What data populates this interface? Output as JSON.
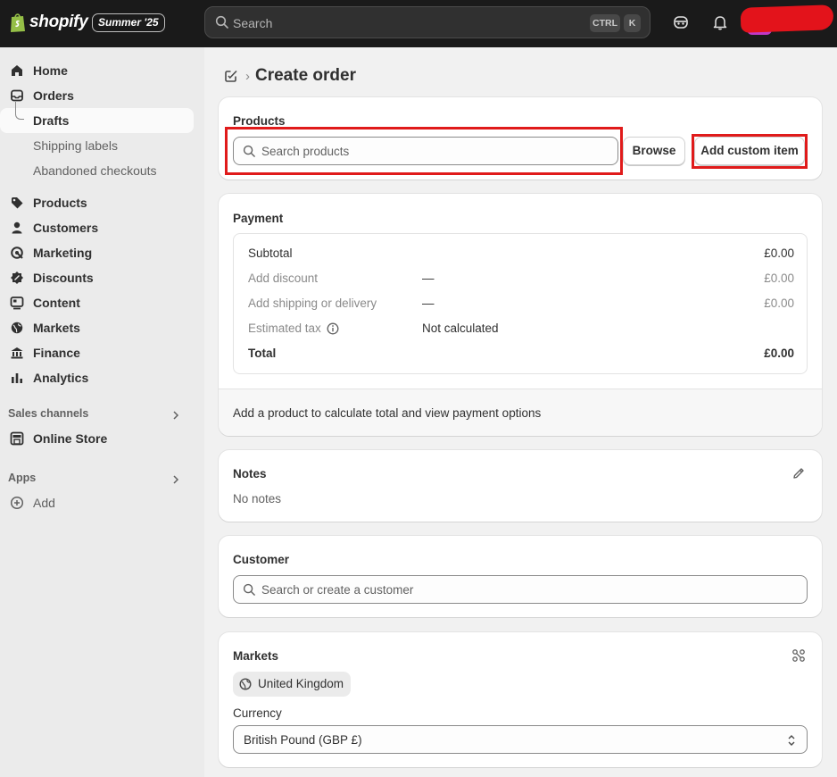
{
  "topbar": {
    "brand": "shopify",
    "edition": "Summer '25",
    "search_placeholder": "Search",
    "shortcut_ctrl": "CTRL",
    "shortcut_k": "K"
  },
  "sidebar": {
    "items": [
      {
        "label": "Home",
        "icon": "home-icon"
      },
      {
        "label": "Orders",
        "icon": "orders-inbox-icon"
      },
      {
        "label": "Drafts"
      },
      {
        "label": "Shipping labels"
      },
      {
        "label": "Abandoned checkouts"
      },
      {
        "label": "Products",
        "icon": "tag-icon"
      },
      {
        "label": "Customers",
        "icon": "person-icon"
      },
      {
        "label": "Marketing",
        "icon": "target-icon"
      },
      {
        "label": "Discounts",
        "icon": "discount-icon"
      },
      {
        "label": "Content",
        "icon": "content-icon"
      },
      {
        "label": "Markets",
        "icon": "globe-icon"
      },
      {
        "label": "Finance",
        "icon": "bank-icon"
      },
      {
        "label": "Analytics",
        "icon": "bar-chart-icon"
      }
    ],
    "sales_channels_label": "Sales channels",
    "online_store_label": "Online Store",
    "apps_label": "Apps",
    "add_label": "Add"
  },
  "page": {
    "title": "Create order"
  },
  "products": {
    "title": "Products",
    "search_placeholder": "Search products",
    "browse_label": "Browse",
    "add_custom_label": "Add custom item"
  },
  "payment": {
    "title": "Payment",
    "rows": [
      {
        "label": "Subtotal",
        "middle": "",
        "value": "£0.00"
      },
      {
        "label": "Add discount",
        "middle": "—",
        "value": "£0.00"
      },
      {
        "label": "Add shipping or delivery",
        "middle": "—",
        "value": "£0.00"
      },
      {
        "label": "Estimated tax",
        "middle": "Not calculated",
        "value": ""
      },
      {
        "label": "Total",
        "middle": "",
        "value": "£0.00"
      }
    ],
    "footer": "Add a product to calculate total and view payment options"
  },
  "notes": {
    "title": "Notes",
    "text": "No notes"
  },
  "customer": {
    "title": "Customer",
    "search_placeholder": "Search or create a customer"
  },
  "markets": {
    "title": "Markets",
    "market": "United Kingdom",
    "currency_label": "Currency",
    "currency_value": "British Pound (GBP £)"
  },
  "colors": {
    "topbar": "#1a1a1a",
    "sidebar": "#ebebeb",
    "background": "#f1f1f1",
    "highlight": "#e01b1b",
    "brand_green": "#95bf47",
    "avatar": "#c238c5"
  }
}
